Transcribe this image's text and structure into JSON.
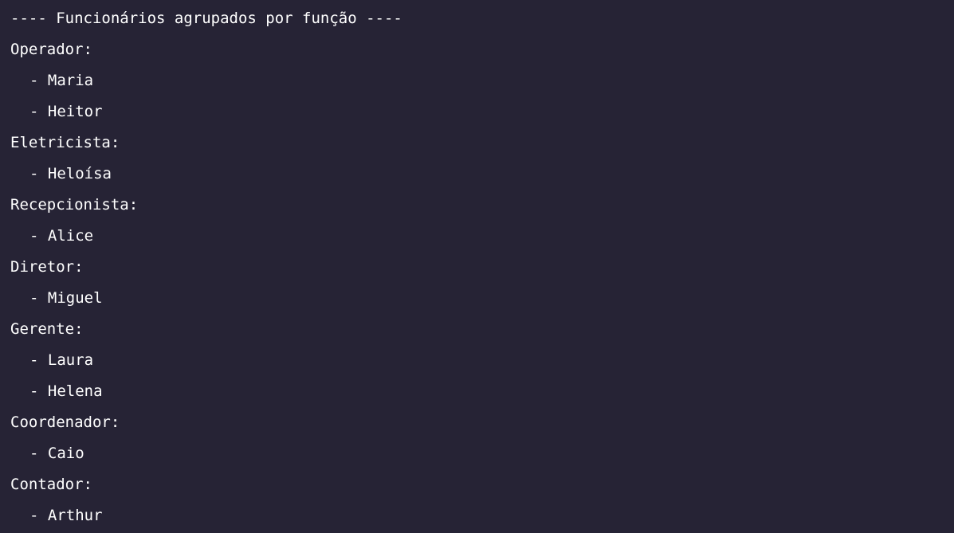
{
  "console": {
    "header": "---- Funcionários agrupados por função ----",
    "groups": [
      {
        "role": "Operador:",
        "members": [
          "- Maria",
          "- Heitor"
        ]
      },
      {
        "role": "Eletricista:",
        "members": [
          "- Heloísa"
        ]
      },
      {
        "role": "Recepcionista:",
        "members": [
          "- Alice"
        ]
      },
      {
        "role": "Diretor:",
        "members": [
          "- Miguel"
        ]
      },
      {
        "role": "Gerente:",
        "members": [
          "- Laura",
          "- Helena"
        ]
      },
      {
        "role": "Coordenador:",
        "members": [
          "- Caio"
        ]
      },
      {
        "role": "Contador:",
        "members": [
          "- Arthur"
        ]
      }
    ]
  }
}
